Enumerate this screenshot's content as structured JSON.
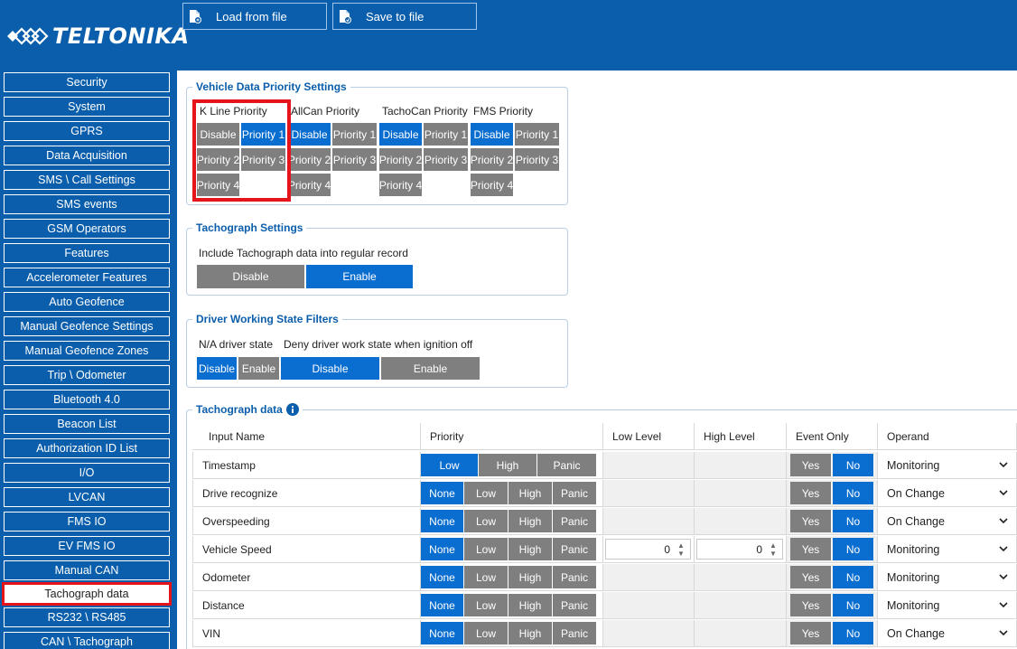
{
  "header": {
    "brand": "TELTONIKA",
    "load_label": "Load from file",
    "save_label": "Save to file"
  },
  "colors": {
    "brand_blue": "#0a5eab",
    "active_blue": "#0a6ed1",
    "inactive_grey": "#7f7f7f",
    "highlight_red": "#e5141a"
  },
  "sidebar": {
    "items": [
      {
        "label": "Security"
      },
      {
        "label": "System"
      },
      {
        "label": "GPRS"
      },
      {
        "label": "Data Acquisition"
      },
      {
        "label": "SMS \\ Call Settings"
      },
      {
        "label": "SMS events"
      },
      {
        "label": "GSM Operators"
      },
      {
        "label": "Features"
      },
      {
        "label": "Accelerometer Features"
      },
      {
        "label": "Auto Geofence"
      },
      {
        "label": "Manual Geofence Settings"
      },
      {
        "label": "Manual Geofence Zones"
      },
      {
        "label": "Trip \\ Odometer"
      },
      {
        "label": "Bluetooth 4.0"
      },
      {
        "label": "Beacon List"
      },
      {
        "label": "Authorization ID List"
      },
      {
        "label": "I/O"
      },
      {
        "label": "LVCAN"
      },
      {
        "label": "FMS IO"
      },
      {
        "label": "EV FMS IO"
      },
      {
        "label": "Manual CAN"
      },
      {
        "label": "Tachograph data"
      },
      {
        "label": "RS232 \\ RS485"
      },
      {
        "label": "CAN \\ Tachograph"
      }
    ],
    "active": "Tachograph data"
  },
  "vehicle_priority": {
    "title": "Vehicle Data Priority Settings",
    "columns": [
      {
        "label": "K Line Priority",
        "selected": "Priority 1"
      },
      {
        "label": "AllCan Priority",
        "selected": "Disable"
      },
      {
        "label": "TachoCan Priority",
        "selected": "Disable"
      },
      {
        "label": "FMS Priority",
        "selected": "Disable"
      }
    ],
    "options": [
      "Disable",
      "Priority 1",
      "Priority 2",
      "Priority 3",
      "Priority 4"
    ]
  },
  "tachograph_settings": {
    "title": "Tachograph Settings",
    "include_label": "Include Tachograph data into regular record",
    "options": [
      "Disable",
      "Enable"
    ],
    "selected": "Enable"
  },
  "driver_filters": {
    "title": "Driver Working State Filters",
    "na_label": "N/A driver state",
    "deny_label": "Deny driver work state when ignition off",
    "na_options": [
      "Disable",
      "Enable"
    ],
    "na_selected": "Disable",
    "deny_options": [
      "Disable",
      "Enable"
    ],
    "deny_selected": "Disable"
  },
  "tacho_data": {
    "title": "Tachograph data",
    "info_icon": "info-icon",
    "headers": [
      "Input Name",
      "Priority",
      "Low Level",
      "High Level",
      "Event Only",
      "Operand"
    ],
    "rows": [
      {
        "name": "Timestamp",
        "priority_options": [
          "Low",
          "High",
          "Panic"
        ],
        "priority": "Low",
        "low": "",
        "high": "",
        "event_only": "No",
        "operand": "Monitoring"
      },
      {
        "name": "Drive recognize",
        "priority_options": [
          "None",
          "Low",
          "High",
          "Panic"
        ],
        "priority": "None",
        "low": "",
        "high": "",
        "event_only": "No",
        "operand": "On Change"
      },
      {
        "name": "Overspeeding",
        "priority_options": [
          "None",
          "Low",
          "High",
          "Panic"
        ],
        "priority": "None",
        "low": "",
        "high": "",
        "event_only": "No",
        "operand": "On Change"
      },
      {
        "name": "Vehicle Speed",
        "priority_options": [
          "None",
          "Low",
          "High",
          "Panic"
        ],
        "priority": "None",
        "low": "0",
        "high": "0",
        "event_only": "No",
        "operand": "Monitoring"
      },
      {
        "name": "Odometer",
        "priority_options": [
          "None",
          "Low",
          "High",
          "Panic"
        ],
        "priority": "None",
        "low": "",
        "high": "",
        "event_only": "No",
        "operand": "Monitoring"
      },
      {
        "name": "Distance",
        "priority_options": [
          "None",
          "Low",
          "High",
          "Panic"
        ],
        "priority": "None",
        "low": "",
        "high": "",
        "event_only": "No",
        "operand": "Monitoring"
      },
      {
        "name": "VIN",
        "priority_options": [
          "None",
          "Low",
          "High",
          "Panic"
        ],
        "priority": "None",
        "low": "",
        "high": "",
        "event_only": "No",
        "operand": "On Change"
      }
    ],
    "event_options": [
      "Yes",
      "No"
    ]
  }
}
